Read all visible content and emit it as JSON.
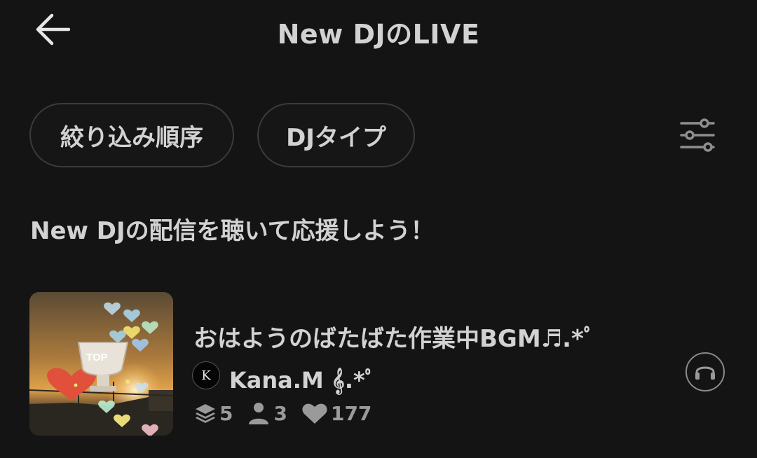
{
  "header": {
    "title": "New DJのLIVE",
    "back_icon": "arrow-left-icon"
  },
  "filters": {
    "sort_label": "絞り込み順序",
    "type_label": "DJタイプ",
    "settings_icon": "sliders-icon"
  },
  "subtitle": "New DJの配信を聴いて応援しよう！",
  "live_list": [
    {
      "title": "おはようのばたばた作業中BGM♬.*ﾟ",
      "thumbnail_badge": "TOP",
      "dj": {
        "avatar_letter": "K",
        "name": "Kana.M 𝄞.*ﾟ"
      },
      "stats": {
        "layers": "5",
        "listeners": "3",
        "likes": "177"
      },
      "listen_icon": "headphones-icon"
    }
  ],
  "colors": {
    "background": "#141414",
    "text": "#d2d2d2",
    "muted": "#9a9a9a",
    "border": "#3b3b3b"
  }
}
